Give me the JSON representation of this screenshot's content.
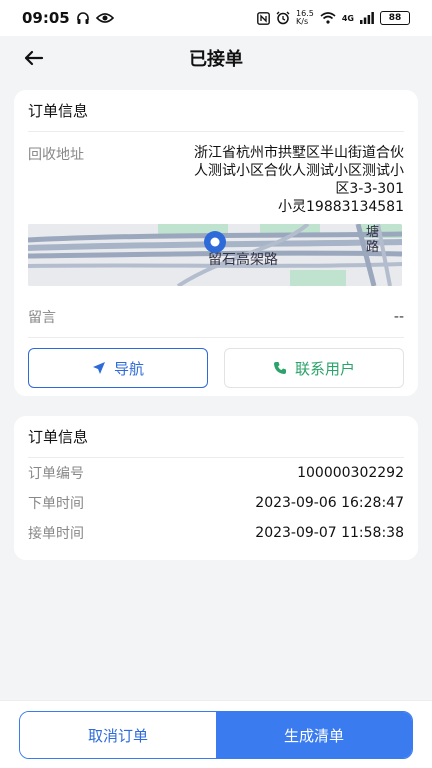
{
  "status_bar": {
    "time": "09:05",
    "network": "4G",
    "speed_top": "16.5",
    "speed_bottom": "K/s",
    "battery": "88"
  },
  "header": {
    "title": "已接单"
  },
  "order_card": {
    "title": "订单信息",
    "address_label": "回收地址",
    "address_line1": "浙江省杭州市拱墅区半山街道合伙",
    "address_line2": "人测试小区合伙人测试小区测试小",
    "address_line3": "区3-3-301",
    "contact": "小灵19883134581",
    "map_road": "留石高架路",
    "map_corner": "塘",
    "map_corner2": "路",
    "note_label": "留言",
    "note_value": "--",
    "navigate_label": "导航",
    "contact_label": "联系用户"
  },
  "info_card": {
    "title": "订单信息",
    "rows": [
      {
        "label": "订单编号",
        "value": "100000302292"
      },
      {
        "label": "下单时间",
        "value": "2023-09-06 16:28:47"
      },
      {
        "label": "接单时间",
        "value": "2023-09-07 11:58:38"
      }
    ]
  },
  "bottom": {
    "cancel_label": "取消订单",
    "generate_label": "生成清单"
  },
  "colors": {
    "accent": "#3a7cf0",
    "contact_green": "#2ba36a"
  }
}
